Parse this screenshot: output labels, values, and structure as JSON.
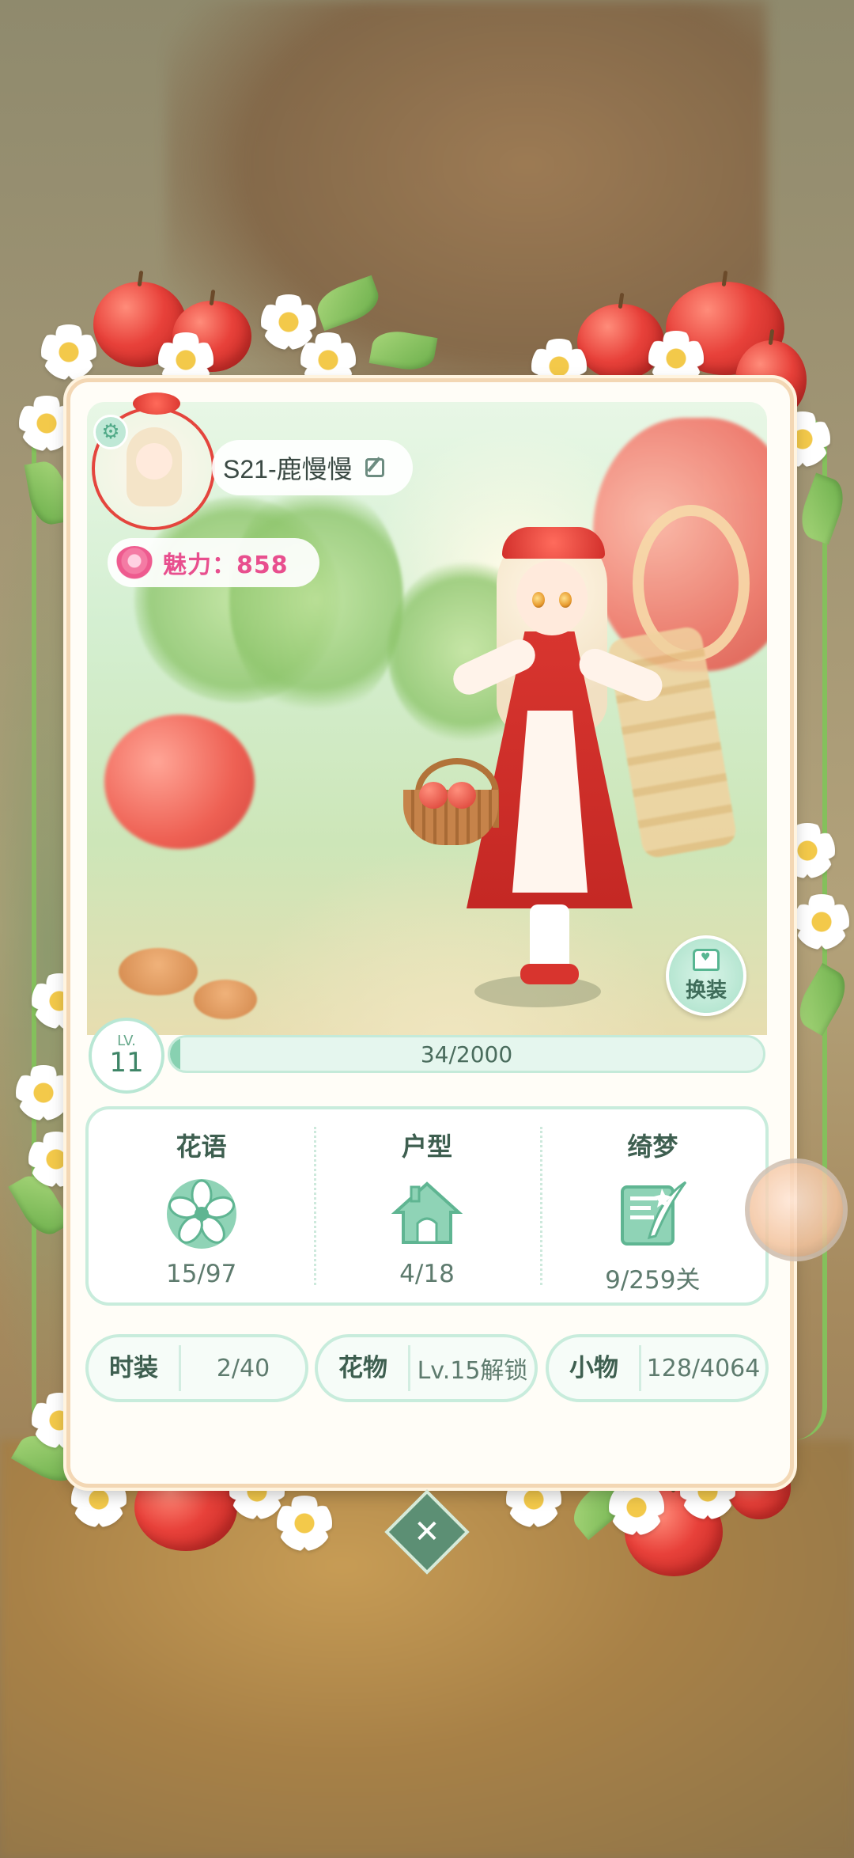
{
  "profile": {
    "name": "S21-鹿慢慢",
    "charm_label": "魅力：858"
  },
  "level": {
    "lv_label": "LV.",
    "value": "11",
    "xp_text": "34/2000",
    "xp_progress": 0.017
  },
  "actions": {
    "dress_label": "换装"
  },
  "stats": [
    {
      "title": "花语",
      "icon": "flower-emblem-icon",
      "value": "15/97"
    },
    {
      "title": "户型",
      "icon": "house-icon",
      "value": "4/18"
    },
    {
      "title": "绮梦",
      "icon": "dream-letter-icon",
      "value": "9/259关"
    }
  ],
  "pills": [
    {
      "key": "时装",
      "value": "2/40"
    },
    {
      "key": "花物",
      "value": "Lv.15解锁"
    },
    {
      "key": "小物",
      "value": "128/4064"
    }
  ],
  "close": {
    "glyph": "✕"
  },
  "theme": {
    "accent": "#88d1b1",
    "charm": "#e84f8e",
    "frame": "#f3d7b4"
  }
}
